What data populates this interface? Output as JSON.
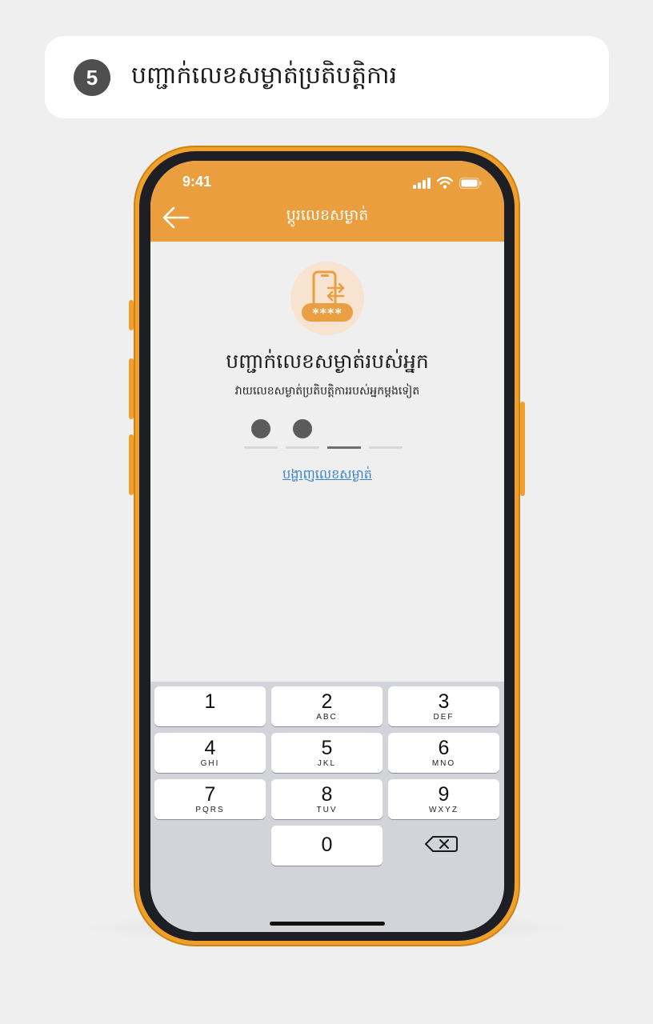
{
  "step": {
    "number": "5",
    "title": "បញ្ជាក់លេខសម្ងាត់ប្រតិបត្តិការ"
  },
  "status_bar": {
    "time": "9:41",
    "icons": [
      "signal-icon",
      "wifi-icon",
      "battery-icon"
    ]
  },
  "header": {
    "title": "ប្តូរលេខសម្ងាត់",
    "back_icon": "back-arrow-icon",
    "color": "#eb9e3e"
  },
  "hero": {
    "icon": "phone-pin-icon",
    "pin_mask": "****"
  },
  "confirm": {
    "title": "បញ្ជាក់លេខសម្ងាត់របស់អ្នក",
    "subtitle": "វាយលេខសម្ងាត់ប្រតិបត្តិការរបស់អ្នកម្តងទៀត"
  },
  "pin": {
    "length": 4,
    "entered": 2,
    "active_index": 2
  },
  "show_pin_label": "បង្ហាញលេខសម្ងាត់",
  "keypad": {
    "keys": [
      {
        "num": "1",
        "letters": ""
      },
      {
        "num": "2",
        "letters": "ABC"
      },
      {
        "num": "3",
        "letters": "DEF"
      },
      {
        "num": "4",
        "letters": "GHI"
      },
      {
        "num": "5",
        "letters": "JKL"
      },
      {
        "num": "6",
        "letters": "MNO"
      },
      {
        "num": "7",
        "letters": "PQRS"
      },
      {
        "num": "8",
        "letters": "TUV"
      },
      {
        "num": "9",
        "letters": "WXYZ"
      }
    ],
    "zero": "0",
    "delete_icon": "backspace-icon"
  },
  "colors": {
    "accent": "#eb9e3e",
    "phone_frame": "#f0a02a",
    "link": "#3b84c4"
  }
}
